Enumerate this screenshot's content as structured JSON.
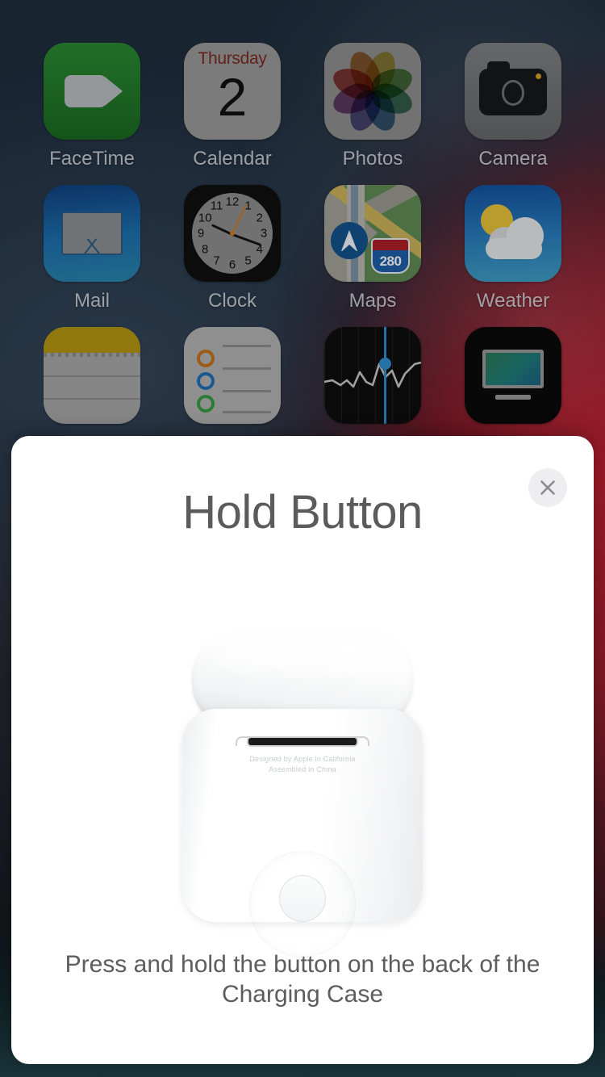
{
  "wallpaper": {
    "top_color": "#1e2d3d",
    "accent_color": "#c41c2c",
    "bottom_color": "#204249"
  },
  "homescreen": {
    "rows": [
      [
        {
          "label": "FaceTime",
          "icon": "facetime-icon"
        },
        {
          "label": "Calendar",
          "icon": "calendar-icon",
          "weekday": "Thursday",
          "date": "2"
        },
        {
          "label": "Photos",
          "icon": "photos-icon"
        },
        {
          "label": "Camera",
          "icon": "camera-icon"
        }
      ],
      [
        {
          "label": "Mail",
          "icon": "mail-icon"
        },
        {
          "label": "Clock",
          "icon": "clock-icon",
          "numbers": [
            "12",
            "1",
            "2",
            "3",
            "4",
            "5",
            "6",
            "7",
            "8",
            "9",
            "10",
            "11"
          ]
        },
        {
          "label": "Maps",
          "icon": "maps-icon",
          "route_shield": "280"
        },
        {
          "label": "Weather",
          "icon": "weather-icon"
        }
      ],
      [
        {
          "label": "",
          "icon": "notes-icon"
        },
        {
          "label": "",
          "icon": "reminders-icon"
        },
        {
          "label": "",
          "icon": "stocks-icon"
        },
        {
          "label": "",
          "icon": "apple-tv-icon"
        }
      ]
    ]
  },
  "modal": {
    "title": "Hold Button",
    "close_icon": "close-icon",
    "illustration": {
      "name": "airpods-charging-case",
      "engraving_line1": "Designed by Apple in California",
      "engraving_line2": "Assembled in China"
    },
    "caption": "Press and hold the button on the back of the Charging Case"
  }
}
